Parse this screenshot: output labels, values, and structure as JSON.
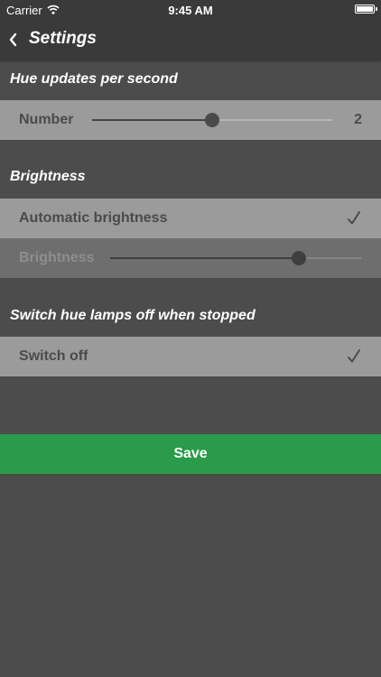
{
  "status_bar": {
    "carrier": "Carrier",
    "time": "9:45 AM",
    "battery_level": 1.0,
    "wifi_icon": "wifi-icon",
    "battery_icon": "battery-icon"
  },
  "nav": {
    "back_icon": "chevron-left-icon",
    "title": "Settings"
  },
  "hue_updates": {
    "header": "Hue updates per second",
    "number_label": "Number",
    "slider_fraction": 0.5,
    "value": "2"
  },
  "brightness": {
    "header": "Brightness",
    "automatic_label": "Automatic brightness",
    "automatic_checked": true,
    "brightness_label": "Brightness",
    "slider_fraction": 0.75
  },
  "switch_off": {
    "header": "Switch hue lamps off when stopped",
    "switch_label": "Switch off",
    "checked": true
  },
  "save_label": "Save",
  "colors": {
    "background": "#4c4c4c",
    "bar": "#3a3a3a",
    "row_light": "#9b9b9b",
    "row_dim": "#6e6e6e",
    "save_green": "#2a9b4a"
  }
}
